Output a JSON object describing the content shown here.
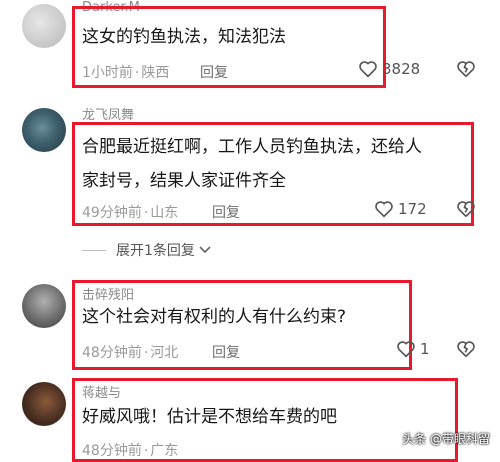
{
  "comments": [
    {
      "username": "Darker.M",
      "lines": [
        "这女的钓鱼执法，知法犯法"
      ],
      "time": "1小时前",
      "location": "陕西",
      "reply": "回复",
      "likes": "3828"
    },
    {
      "username": "龙飞凤舞",
      "lines": [
        "合肥最近挺红啊，工作人员钓鱼执法，还给人",
        "家封号，结果人家证件齐全"
      ],
      "time": "49分钟前",
      "location": "山东",
      "reply": "回复",
      "likes": "172"
    },
    {
      "username": "击碎残阳",
      "lines": [
        "这个社会对有权利的人有什么约束?"
      ],
      "time": "48分钟前",
      "location": "河北",
      "reply": "回复",
      "likes": "1"
    },
    {
      "username": "蒋越与",
      "lines": [
        "好威风哦！估计是不想给车费的吧"
      ],
      "time": "48分钟前",
      "location": "广东",
      "reply": "",
      "likes": ""
    }
  ],
  "expand_replies": "展开1条回复",
  "watermark": "头条 @带眼科留",
  "colors": {
    "highlight_box": "#e8182d",
    "meta_text": "#9a9a9a"
  },
  "icons": {
    "like": "heart-outline-icon",
    "dislike": "broken-heart-icon",
    "expand": "chevron-down-icon"
  }
}
